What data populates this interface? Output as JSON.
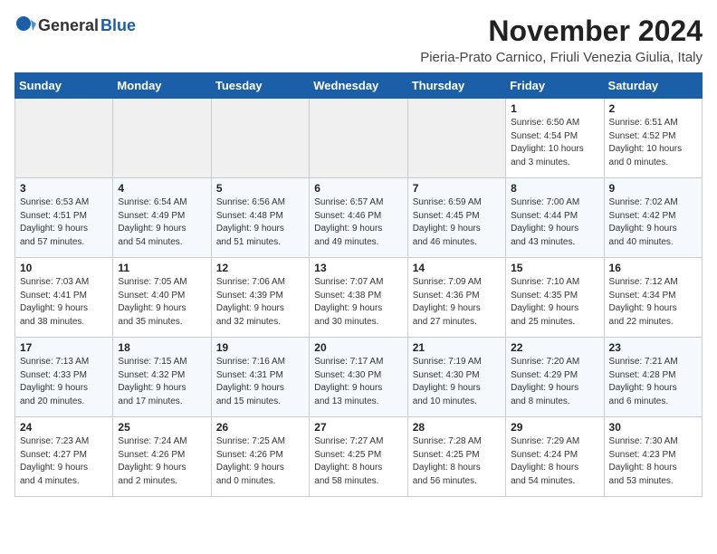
{
  "logo": {
    "general": "General",
    "blue": "Blue"
  },
  "title": "November 2024",
  "subtitle": "Pieria-Prato Carnico, Friuli Venezia Giulia, Italy",
  "headers": [
    "Sunday",
    "Monday",
    "Tuesday",
    "Wednesday",
    "Thursday",
    "Friday",
    "Saturday"
  ],
  "weeks": [
    [
      {
        "day": "",
        "info": ""
      },
      {
        "day": "",
        "info": ""
      },
      {
        "day": "",
        "info": ""
      },
      {
        "day": "",
        "info": ""
      },
      {
        "day": "",
        "info": ""
      },
      {
        "day": "1",
        "info": "Sunrise: 6:50 AM\nSunset: 4:54 PM\nDaylight: 10 hours\nand 3 minutes."
      },
      {
        "day": "2",
        "info": "Sunrise: 6:51 AM\nSunset: 4:52 PM\nDaylight: 10 hours\nand 0 minutes."
      }
    ],
    [
      {
        "day": "3",
        "info": "Sunrise: 6:53 AM\nSunset: 4:51 PM\nDaylight: 9 hours\nand 57 minutes."
      },
      {
        "day": "4",
        "info": "Sunrise: 6:54 AM\nSunset: 4:49 PM\nDaylight: 9 hours\nand 54 minutes."
      },
      {
        "day": "5",
        "info": "Sunrise: 6:56 AM\nSunset: 4:48 PM\nDaylight: 9 hours\nand 51 minutes."
      },
      {
        "day": "6",
        "info": "Sunrise: 6:57 AM\nSunset: 4:46 PM\nDaylight: 9 hours\nand 49 minutes."
      },
      {
        "day": "7",
        "info": "Sunrise: 6:59 AM\nSunset: 4:45 PM\nDaylight: 9 hours\nand 46 minutes."
      },
      {
        "day": "8",
        "info": "Sunrise: 7:00 AM\nSunset: 4:44 PM\nDaylight: 9 hours\nand 43 minutes."
      },
      {
        "day": "9",
        "info": "Sunrise: 7:02 AM\nSunset: 4:42 PM\nDaylight: 9 hours\nand 40 minutes."
      }
    ],
    [
      {
        "day": "10",
        "info": "Sunrise: 7:03 AM\nSunset: 4:41 PM\nDaylight: 9 hours\nand 38 minutes."
      },
      {
        "day": "11",
        "info": "Sunrise: 7:05 AM\nSunset: 4:40 PM\nDaylight: 9 hours\nand 35 minutes."
      },
      {
        "day": "12",
        "info": "Sunrise: 7:06 AM\nSunset: 4:39 PM\nDaylight: 9 hours\nand 32 minutes."
      },
      {
        "day": "13",
        "info": "Sunrise: 7:07 AM\nSunset: 4:38 PM\nDaylight: 9 hours\nand 30 minutes."
      },
      {
        "day": "14",
        "info": "Sunrise: 7:09 AM\nSunset: 4:36 PM\nDaylight: 9 hours\nand 27 minutes."
      },
      {
        "day": "15",
        "info": "Sunrise: 7:10 AM\nSunset: 4:35 PM\nDaylight: 9 hours\nand 25 minutes."
      },
      {
        "day": "16",
        "info": "Sunrise: 7:12 AM\nSunset: 4:34 PM\nDaylight: 9 hours\nand 22 minutes."
      }
    ],
    [
      {
        "day": "17",
        "info": "Sunrise: 7:13 AM\nSunset: 4:33 PM\nDaylight: 9 hours\nand 20 minutes."
      },
      {
        "day": "18",
        "info": "Sunrise: 7:15 AM\nSunset: 4:32 PM\nDaylight: 9 hours\nand 17 minutes."
      },
      {
        "day": "19",
        "info": "Sunrise: 7:16 AM\nSunset: 4:31 PM\nDaylight: 9 hours\nand 15 minutes."
      },
      {
        "day": "20",
        "info": "Sunrise: 7:17 AM\nSunset: 4:30 PM\nDaylight: 9 hours\nand 13 minutes."
      },
      {
        "day": "21",
        "info": "Sunrise: 7:19 AM\nSunset: 4:30 PM\nDaylight: 9 hours\nand 10 minutes."
      },
      {
        "day": "22",
        "info": "Sunrise: 7:20 AM\nSunset: 4:29 PM\nDaylight: 9 hours\nand 8 minutes."
      },
      {
        "day": "23",
        "info": "Sunrise: 7:21 AM\nSunset: 4:28 PM\nDaylight: 9 hours\nand 6 minutes."
      }
    ],
    [
      {
        "day": "24",
        "info": "Sunrise: 7:23 AM\nSunset: 4:27 PM\nDaylight: 9 hours\nand 4 minutes."
      },
      {
        "day": "25",
        "info": "Sunrise: 7:24 AM\nSunset: 4:26 PM\nDaylight: 9 hours\nand 2 minutes."
      },
      {
        "day": "26",
        "info": "Sunrise: 7:25 AM\nSunset: 4:26 PM\nDaylight: 9 hours\nand 0 minutes."
      },
      {
        "day": "27",
        "info": "Sunrise: 7:27 AM\nSunset: 4:25 PM\nDaylight: 8 hours\nand 58 minutes."
      },
      {
        "day": "28",
        "info": "Sunrise: 7:28 AM\nSunset: 4:25 PM\nDaylight: 8 hours\nand 56 minutes."
      },
      {
        "day": "29",
        "info": "Sunrise: 7:29 AM\nSunset: 4:24 PM\nDaylight: 8 hours\nand 54 minutes."
      },
      {
        "day": "30",
        "info": "Sunrise: 7:30 AM\nSunset: 4:23 PM\nDaylight: 8 hours\nand 53 minutes."
      }
    ]
  ]
}
